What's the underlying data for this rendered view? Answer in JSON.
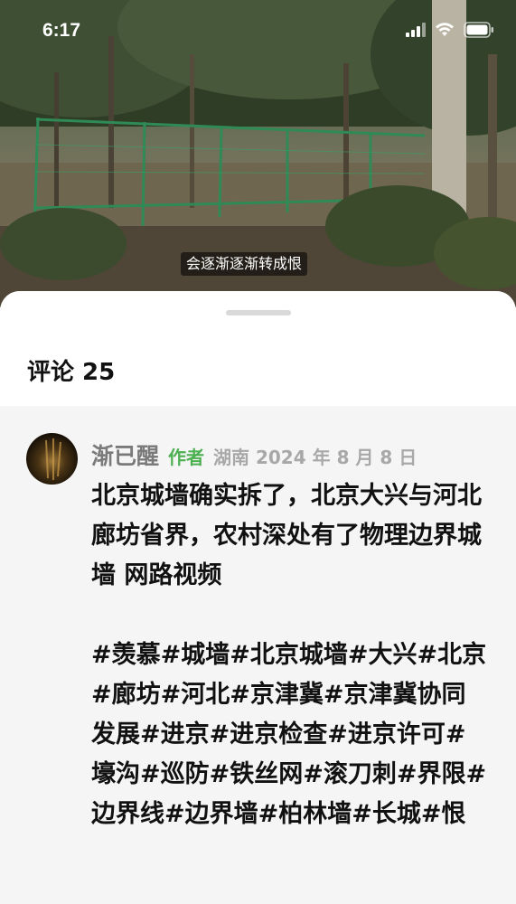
{
  "status_bar": {
    "time": "6:17"
  },
  "video": {
    "subtitle": "会逐渐逐渐转成恨"
  },
  "comments": {
    "title": "评论 25",
    "items": [
      {
        "author": "渐已醒",
        "badge": "作者",
        "location_date": "湖南 2024 年 8 月 8 日",
        "text": "北京城墙确实拆了，北京大兴与河北廊坊省界，农村深处有了物理边界城墙 网路视频\n\n#羡慕#城墙#北京城墙#大兴#北京#廊坊#河北#京津冀#京津冀协同发展#进京#进京检查#进京许可#壕沟#巡防#铁丝网#滚刀刺#界限#边界线#边界墙#柏林墙#长城#恨"
      }
    ]
  },
  "colors": {
    "author_badge": "#4caf50",
    "sheet_bg": "#f5f5f5",
    "header_bg": "#ffffff"
  },
  "icons": [
    "signal-icon",
    "wifi-icon",
    "battery-icon",
    "sheet-handle"
  ]
}
